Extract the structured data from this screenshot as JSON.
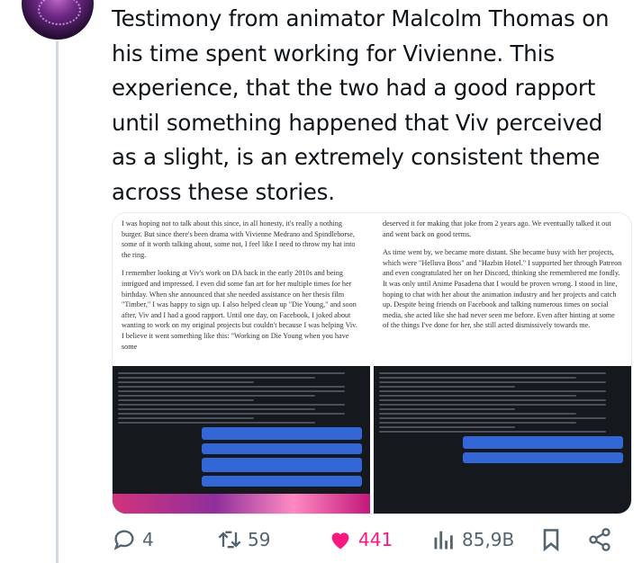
{
  "tweet": {
    "text": "Testimony from animator Malcolm Thomas on his time spent working for Vivienne. This experience, that the two had a good rapport until something happened that Viv perceived as a slight, is an extremely consistent theme across these stories."
  },
  "media": {
    "image1": {
      "paragraphs": [
        "I was hoping not to talk about this since, in all honesty, it's really a nothing burger. But since there's been drama with Vivienne Medrano and Spindlehorse, some of it worth talking about, some not, I feel like I need to throw my hat into the ring.",
        "I remember looking at Viv's work on DA back in the early 2010s and being intrigued and impressed. I even did some fan art for her multiple times for her birthday. When she announced that she needed assistance on her thesis film \"Timber,\" I was happy to sign up. I also helped clean up \"Die Young,\" and soon after, Viv and I had a good rapport. Until one day, on Facebook, I joked about wanting to work on my original projects but couldn't because I was helping Viv. I believe it went something like this: \"Working on Die Young when you have some"
      ]
    },
    "image2": {
      "paragraphs": [
        "deserved it for making that joke from 2 years ago. We eventually talked it out and went back on good terms.",
        "As time went by, we became more distant. She became busy with her projects, which were \"Helluva Boss\" and \"Hazbin Hotel.\" I supported her through Patreon and even congratulated her on her Discord, thinking she remembered me fondly. It was only until Anime Pasadena that I would be proven wrong. I stood in line, hoping to chat with her about the animation industry and her projects and catch up. Despite being friends on Facebook and talking numerous times on social media, she acted like she had never seen me before. Even after hinting at some of the things I've done for her, she still acted dismissively towards me."
      ]
    },
    "image3": {
      "chat": "dark"
    },
    "image4": {
      "chat": "dark"
    }
  },
  "actions": {
    "reply_count": "4",
    "retweet_count": "59",
    "like_count": "441",
    "views_count": "85,9B"
  },
  "colors": {
    "like": "#f91880",
    "action_gray": "#536471",
    "thread_line": "#cfd9de"
  },
  "icons": [
    "avatar",
    "reply-icon",
    "retweet-icon",
    "heart-icon",
    "views-icon",
    "bookmark-icon",
    "share-icon"
  ]
}
